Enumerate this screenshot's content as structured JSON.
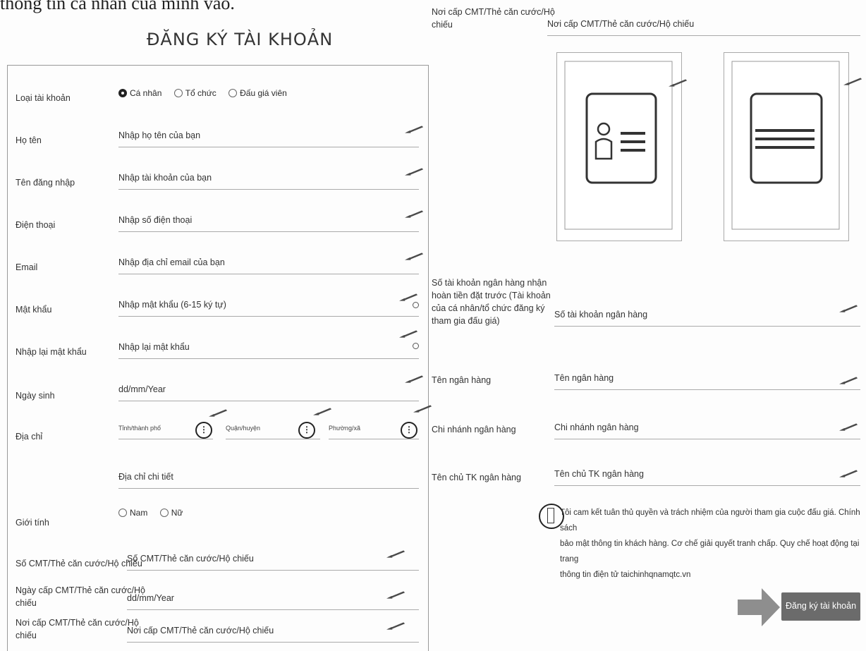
{
  "intro_text": "thông tin cá nhân của mình vào.",
  "form_title": "ĐĂNG KÝ TÀI KHOẢN",
  "account_type": {
    "label": "Loại tài khoản",
    "options": [
      "Cá nhân",
      "Tổ chức",
      "Đấu giá viên"
    ],
    "selected": "Cá nhân"
  },
  "fields": {
    "full_name": {
      "label": "Họ tên",
      "placeholder": "Nhập họ tên của bạn"
    },
    "username": {
      "label": "Tên đăng nhập",
      "placeholder": "Nhập tài khoản của bạn"
    },
    "phone": {
      "label": "Điện thoại",
      "placeholder": "Nhập số điện thoại"
    },
    "email": {
      "label": "Email",
      "placeholder": "Nhập địa chỉ email của bạn"
    },
    "password": {
      "label": "Mật khẩu",
      "placeholder": "Nhập mật khẩu (6-15 ký tự)"
    },
    "confirm_password": {
      "label": "Nhập lại mật khẩu",
      "placeholder": "Nhập lại mật khẩu"
    },
    "birthday": {
      "label": "Ngày sinh",
      "placeholder": "dd/mm/Year"
    },
    "address": {
      "label": "Địa chỉ",
      "province": "Tỉnh/thành phố",
      "district": "Quận/huyện",
      "ward": "Phường/xã",
      "detail_placeholder": "Địa chỉ chi tiết"
    },
    "gender": {
      "label": "Giới tính",
      "options": [
        "Nam",
        "Nữ"
      ]
    },
    "id_number": {
      "label": "Số CMT/Thẻ căn cước/Hộ chiếu",
      "placeholder": "Số CMT/Thẻ căn cước/Hộ chiếu"
    },
    "id_issue_date": {
      "label_line1": "Ngày cấp CMT/Thẻ căn cước/Hộ",
      "label_line2": "chiếu",
      "placeholder": "dd/mm/Year"
    },
    "id_issue_place": {
      "label_line1": "Nơi cấp CMT/Thẻ căn cước/Hộ",
      "label_line2": "chiếu",
      "placeholder": "Nơi cấp CMT/Thẻ căn cước/Hộ chiếu"
    }
  },
  "right": {
    "id_issue_place": {
      "label_line1": "Nơi cấp CMT/Thẻ căn cước/Hộ",
      "label_line2": "chiếu",
      "placeholder": "Nơi cấp CMT/Thẻ căn cước/Hộ chiếu"
    },
    "bank_account": {
      "label_lines": [
        "Số tài khoản ngân hàng nhận",
        "hoàn tiền đặt trước (Tài khoản",
        "của cá nhân/tổ chức đăng ký",
        "tham gia đấu giá)"
      ],
      "placeholder": "Số tài khoản ngân hàng"
    },
    "bank_name": {
      "label": "Tên ngân hàng",
      "placeholder": "Tên ngân hàng"
    },
    "bank_branch": {
      "label": "Chi nhánh ngân hàng",
      "placeholder": "Chi nhánh ngân hàng"
    },
    "bank_owner": {
      "label": "Tên chủ TK ngân hàng",
      "placeholder": "Tên chủ TK ngân hàng"
    },
    "agreement_lines": [
      "Tôi cam kết tuân thủ quyền và trách nhiệm của người tham gia cuộc đấu giá. Chính sách",
      "bảo mật thông tin khách hàng. Cơ chế giải quyết tranh chấp. Quy chế hoạt động tại trang",
      "thông tin điện tử taichinhqnamqtc.vn"
    ],
    "submit_label": "Đăng ký tài khoản"
  },
  "colors": {
    "button": "#6b6b6b",
    "arrow": "#555555",
    "line": "#aaaaaa"
  }
}
